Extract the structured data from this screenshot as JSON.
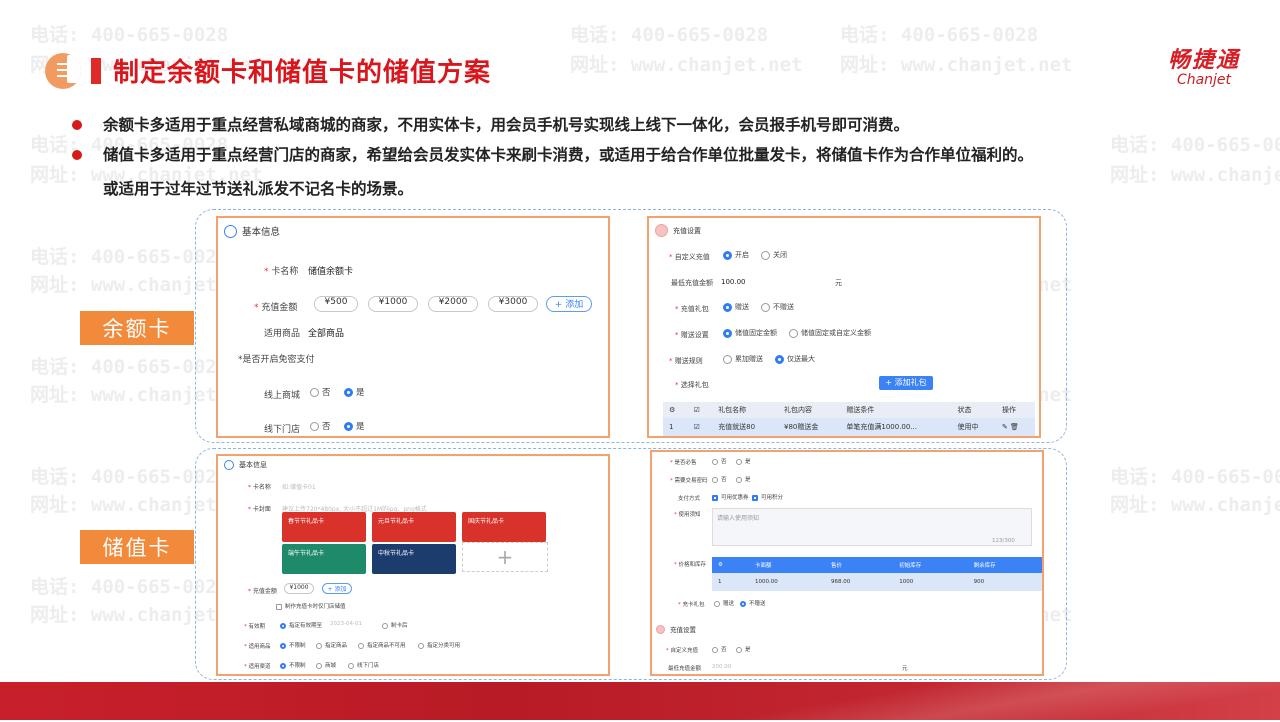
{
  "watermark": {
    "phone": "电话: 400-665-0028",
    "site": "网址: www.chanjet.net"
  },
  "title": "制定余额卡和储值卡的储值方案",
  "brand": {
    "cn": "畅捷通",
    "en": "Chanjet"
  },
  "bullets": [
    "余额卡多适用于重点经营私域商城的商家，不用实体卡，用会员手机号实现线上线下一体化，会员报手机号即可消费。",
    "储值卡多适用于重点经营门店的商家，希望给会员发实体卡来刷卡消费，或适用于给合作单位批量发卡，将储值卡作为合作单位福利的。"
  ],
  "bullet2_cont": "或适用于过年过节送礼派发不记名卡的场景。",
  "tags": {
    "balance": "余额卡",
    "stored": "储值卡"
  },
  "p1": {
    "title": "基本信息",
    "card_name_label": "卡名称",
    "card_name_value": "储值余额卡",
    "amount_label": "充值金额",
    "amounts": [
      "¥500",
      "¥1000",
      "¥2000",
      "¥3000"
    ],
    "add": "+ 添加",
    "goods_label": "适用商品",
    "goods_value": "全部商品",
    "nopwd_label": "*是否开启免密支付",
    "online_label": "线上商城",
    "offline_label": "线下门店",
    "no": "否",
    "yes": "是"
  },
  "p2": {
    "title": "充值设置",
    "custom_label": "自定义充值",
    "open": "开启",
    "close": "关闭",
    "min_label": "最低充值金额",
    "min_value": "100.00",
    "unit": "元",
    "gift_label": "充值礼包",
    "give": "赠送",
    "nogive": "不赠送",
    "giveset_label": "赠送设置",
    "opt1": "储值固定金额",
    "opt2": "储值固定或自定义金额",
    "rule_label": "赠送规则",
    "rule1": "累加赠送",
    "rule2": "仅送最大",
    "select_label": "选择礼包",
    "add_btn": "+ 添加礼包",
    "headers": [
      "",
      "",
      "礼包名称",
      "礼包内容",
      "赠送条件",
      "状态",
      "操作"
    ],
    "row": [
      "1",
      "",
      "充值就送80",
      "¥80赠送金",
      "单笔充值满1000.00...",
      "使用中",
      ""
    ]
  },
  "p3": {
    "title": "基本信息",
    "name_label": "卡名称",
    "name_ph": "如:储值卡01",
    "cover_label": "卡封面",
    "cover_hint": "建议上传720*480px, 大小不超过1M的jpg、png格式",
    "thumbs": [
      "春节节礼品卡",
      "元旦节礼品卡",
      "国庆节礼品卡",
      "端午节礼品卡",
      "中秋节礼品卡"
    ],
    "amount_label": "充值金额",
    "amount_value": "¥1000",
    "add": "+ 添加",
    "note": "制作充值卡时仅门店储值",
    "valid_label": "有效期",
    "valid_opt": "指定有效期至",
    "valid_date": "2023-04-01",
    "valid_opt2": "制卡后",
    "goods_label": "适用商品",
    "goods_opts": [
      "不限制",
      "指定商品",
      "指定商品不可用",
      "指定分类可用"
    ],
    "channel_label": "适用渠道",
    "channel_opts": [
      "不限制",
      "商城",
      "线下门店"
    ]
  },
  "p4": {
    "q1": "是否必售",
    "q2": "需要交易密码",
    "q3": "支付方式",
    "pay_opts": [
      "可用优惠券",
      "可用积分"
    ],
    "notice_label": "使用须知",
    "notice": "请输入使用须知",
    "count": "123/300",
    "price_label": "价格和库存",
    "headers": [
      "",
      "卡面额",
      "售价",
      "初始库存",
      "剩余库存"
    ],
    "row": [
      "1",
      "1000.00",
      "968.00",
      "1000",
      "900"
    ],
    "gift_label": "充卡礼包",
    "give": "赠送",
    "nogive": "不赠送",
    "recharge_title": "充值设置",
    "custom_label": "自定义充值",
    "min_label": "最低充值金额",
    "min_value": "200.00",
    "unit": "元",
    "no": "否",
    "yes": "是"
  }
}
